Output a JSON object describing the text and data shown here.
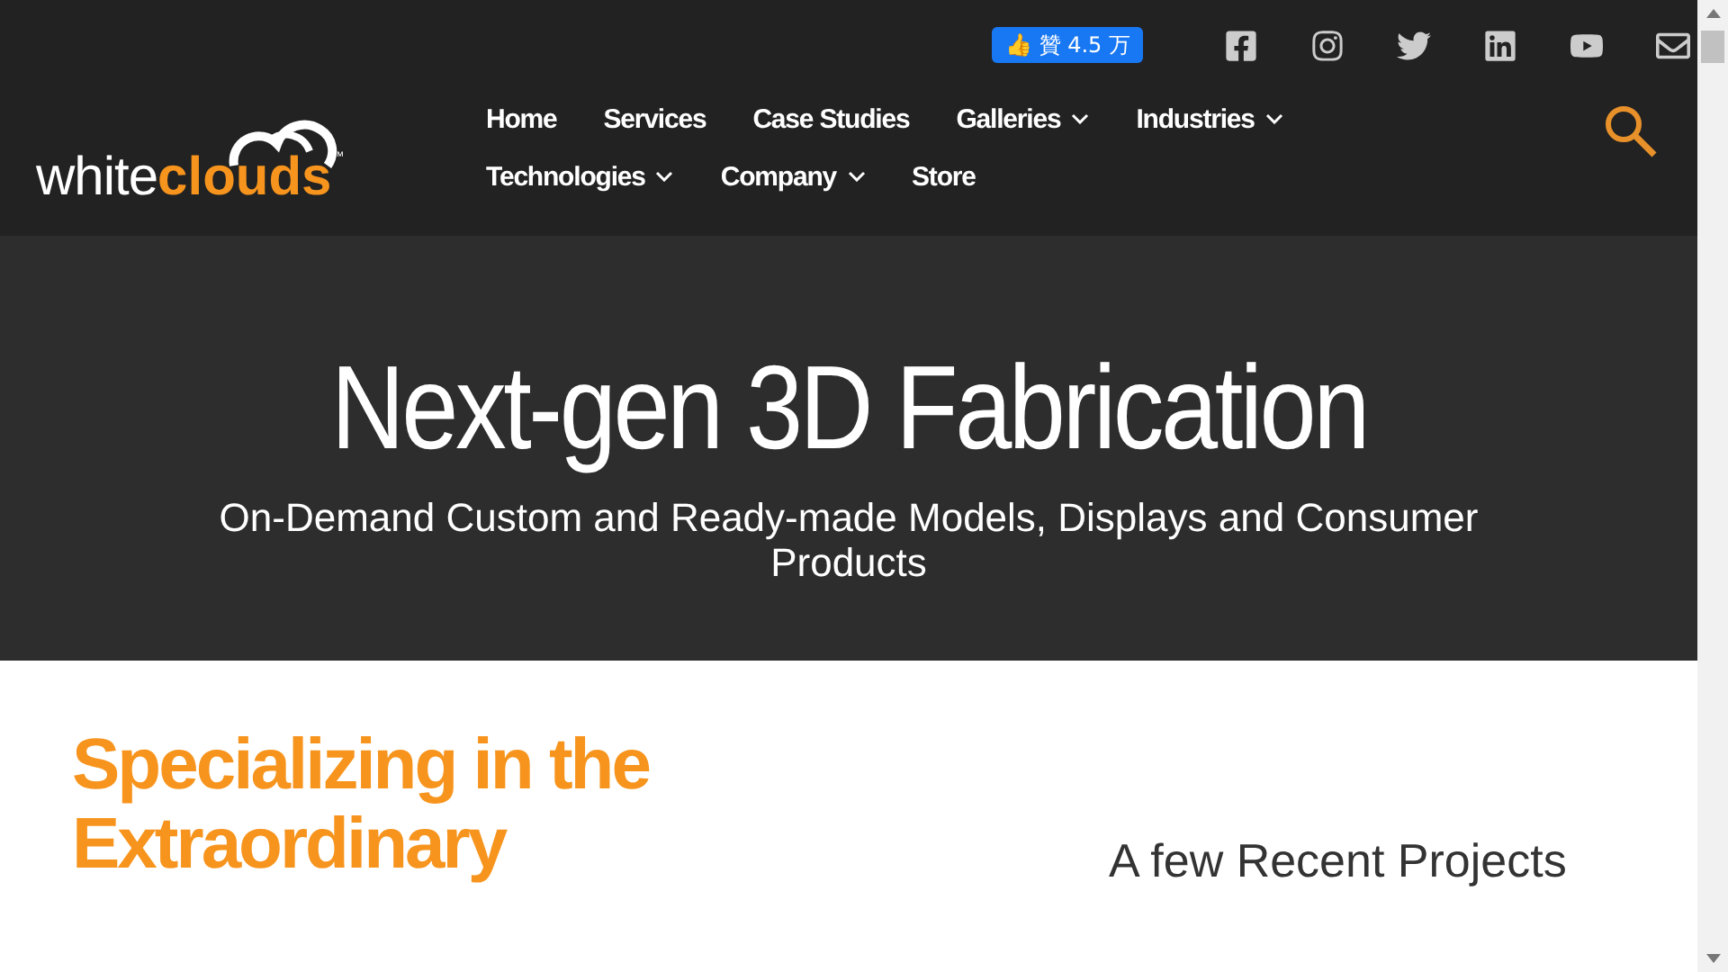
{
  "header": {
    "logo": {
      "light": "white",
      "accent": "clouds",
      "mark": "™"
    },
    "like_button": {
      "icon": "👍",
      "label": "贊 4.5 万"
    },
    "nav": [
      {
        "label": "Home",
        "has_menu": false
      },
      {
        "label": "Services",
        "has_menu": false
      },
      {
        "label": "Case Studies",
        "has_menu": false
      },
      {
        "label": "Galleries",
        "has_menu": true
      },
      {
        "label": "Industries",
        "has_menu": true
      },
      {
        "label": "Technologies",
        "has_menu": true
      },
      {
        "label": "Company",
        "has_menu": true
      },
      {
        "label": "Store",
        "has_menu": false
      }
    ]
  },
  "hero": {
    "title": "Next-gen 3D Fabrication",
    "subtitle": "On-Demand Custom and Ready-made Models, Displays and Consumer Products"
  },
  "section": {
    "heading": "Specializing in the Extraordinary",
    "side_heading": "A few Recent Projects"
  }
}
